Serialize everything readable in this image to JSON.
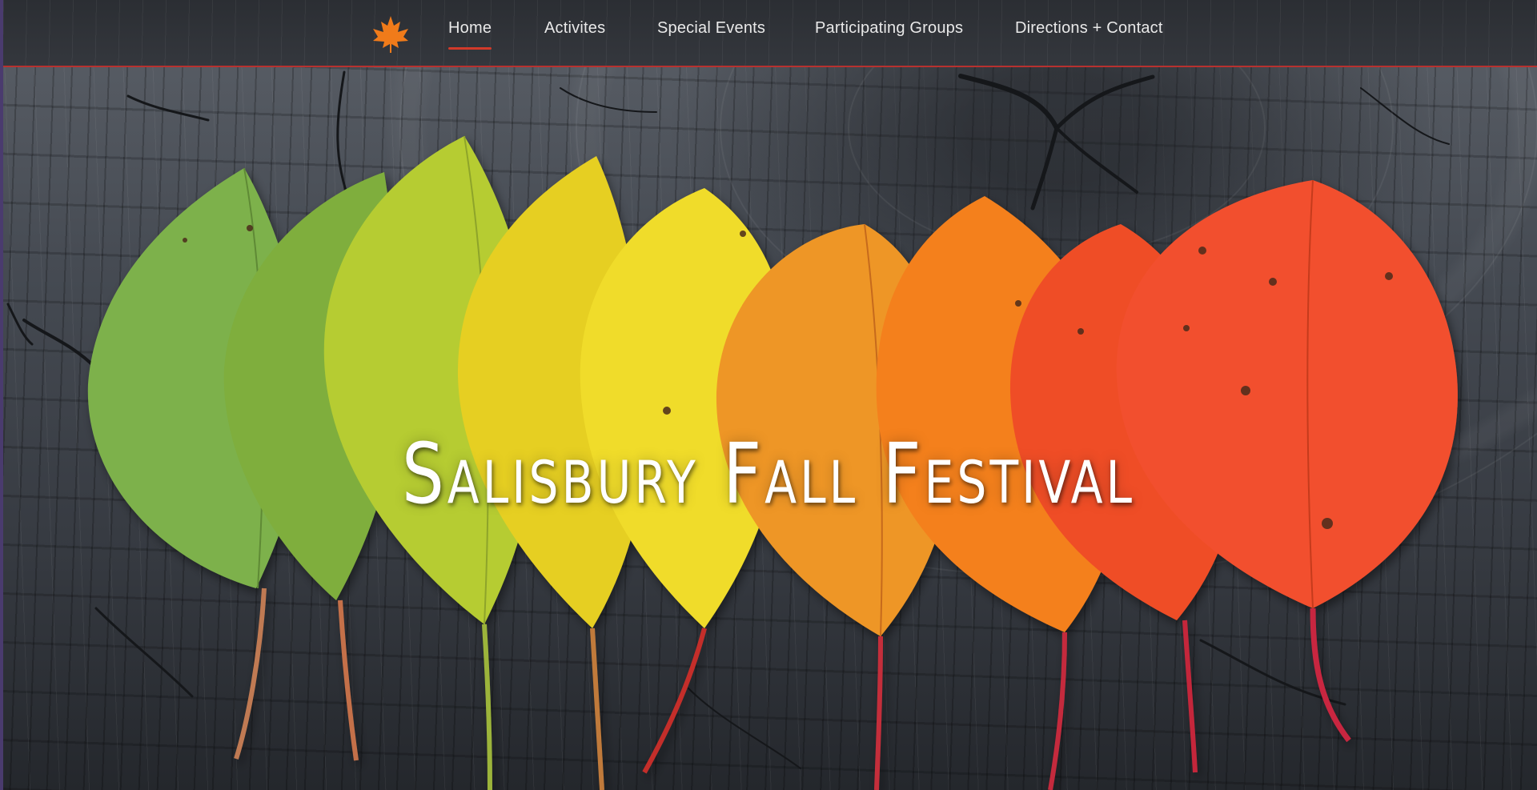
{
  "site": {
    "title": "Salisbury Fall Festival",
    "logo_icon": "maple-leaf-icon",
    "accent_color": "#d23a2a"
  },
  "nav": {
    "items": [
      {
        "label": "Home",
        "active": true
      },
      {
        "label": "Activites",
        "active": false
      },
      {
        "label": "Special Events",
        "active": false
      },
      {
        "label": "Participating Groups",
        "active": false
      },
      {
        "label": "Directions + Contact",
        "active": false
      }
    ]
  },
  "hero": {
    "background": "weathered-wood-stump",
    "leaf_colors": [
      "#7bb04a",
      "#86b43e",
      "#b7cc35",
      "#e8d22a",
      "#f0de2f",
      "#f09a2b",
      "#f5861f",
      "#f0502a",
      "#f2513a"
    ]
  }
}
